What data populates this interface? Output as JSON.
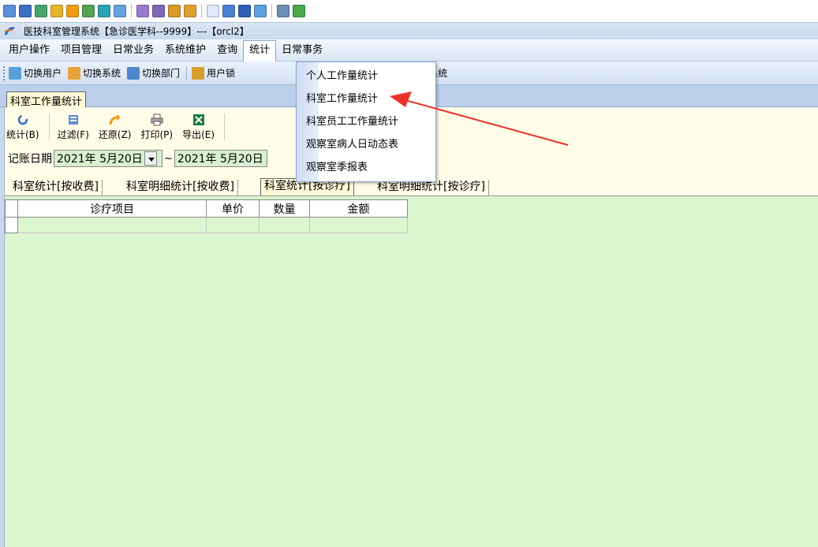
{
  "title_bar": {
    "text": "医技科室管理系统【急诊医学科--9999】---【orcl2】"
  },
  "menubar": {
    "items": [
      "用户操作",
      "项目管理",
      "日常业务",
      "系统维护",
      "查询",
      "统计",
      "日常事务"
    ]
  },
  "toolbar": {
    "switch_user": "切换用户",
    "switch_system": "切换系统",
    "switch_dept": "切换部门",
    "user_lock": "用户锁",
    "exit_system": "退出系统"
  },
  "doc_tab": {
    "label": "科室工作量统计"
  },
  "inner_toolbar": {
    "stat": "统计(B)",
    "filter": "过滤(F)",
    "restore": "还原(Z)",
    "print": "打印(P)",
    "export": "导出(E)"
  },
  "date_row": {
    "label": "记账日期",
    "from": "2021年  5月20日",
    "to": "2021年  5月20日",
    "tilde": "~"
  },
  "sub_tabs": [
    "科室统计[按收费]",
    "科室明细统计[按收费]",
    "科室统计[按诊疗]",
    "科室明细统计[按诊疗]"
  ],
  "grid": {
    "headers": [
      "诊疗项目",
      "单价",
      "数量",
      "金额"
    ]
  },
  "dropdown": {
    "items": [
      "个人工作量统计",
      "科室工作量统计",
      "科室员工工作量统计",
      "观察室病人日动态表",
      "观察室季报表"
    ]
  },
  "colors": {
    "accent_arrow": "#e8312a",
    "grid_bg": "#dcf6d0",
    "panel_bg": "#fffde8"
  }
}
